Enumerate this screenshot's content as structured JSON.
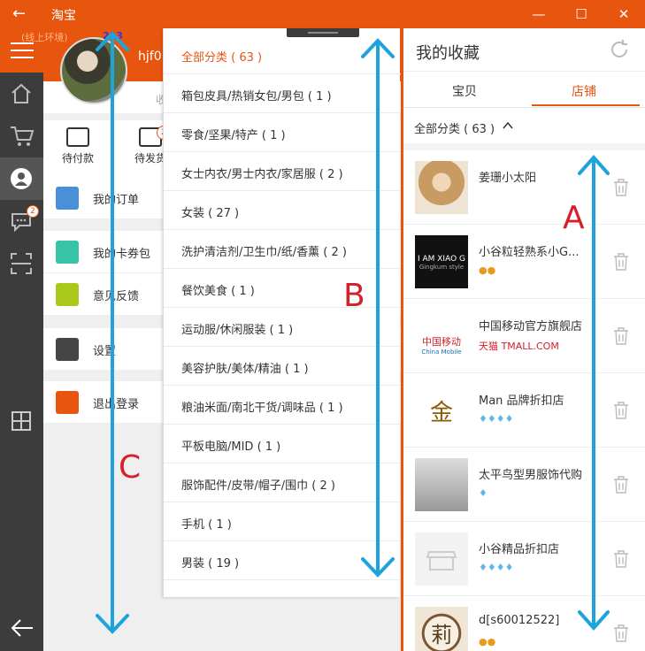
{
  "titlebar": {
    "back": "←",
    "title": "淘宝",
    "minimize": "—",
    "maximize": "☐",
    "close": "✕"
  },
  "rail": {
    "message_badge": "2"
  },
  "drawer": {
    "env_label": "(线上环境)",
    "count_label": "213",
    "username": "hjf0",
    "hint": "收",
    "orders": [
      {
        "label": "待付款"
      },
      {
        "label": "待发货",
        "badge": "2"
      }
    ],
    "menu_group1": [
      "我的订单"
    ],
    "menu_group2": [
      "我的卡券包",
      "意见反馈"
    ],
    "menu_group3": [
      "设置"
    ],
    "menu_group4": [
      "退出登录"
    ]
  },
  "categories": [
    "全部分类 ( 63 )",
    "箱包皮具/热销女包/男包 ( 1 )",
    "零食/坚果/特产 ( 1 )",
    "女士内衣/男士内衣/家居服 ( 2 )",
    "女装 ( 27 )",
    "洗护清洁剂/卫生巾/纸/香薰 ( 2 )",
    "餐饮美食 ( 1 )",
    "运动服/休闲服装 ( 1 )",
    "美容护肤/美体/精油 ( 1 )",
    "粮油米面/南北干货/调味品 ( 1 )",
    "平板电脑/MID ( 1 )",
    "服饰配件/皮带/帽子/围巾 ( 2 )",
    "手机 ( 1 )",
    "男装 ( 19 )"
  ],
  "favorites": {
    "title": "我的收藏",
    "tabs": [
      "宝贝",
      "店铺"
    ],
    "active_tab": "店铺",
    "filter": "全部分类 ( 63 )",
    "shops": [
      {
        "name": "姜珊小太阳",
        "rating": ""
      },
      {
        "name": "小谷粒轻熟系小G...",
        "rating": "●●",
        "logo_text": "I AM XIAO G",
        "logo_sub": "Gingkum style"
      },
      {
        "name": "中国移动官方旗舰店",
        "rating": "天猫 TMALL.COM",
        "logo_text": "中国移动",
        "logo_sub": "China Mobile"
      },
      {
        "name": "Man 品牌折扣店",
        "rating": "♦♦♦♦",
        "logo_text": "金"
      },
      {
        "name": "太平鸟型男服饰代购",
        "rating": "♦"
      },
      {
        "name": "小谷精品折扣店",
        "rating": "♦♦♦♦"
      },
      {
        "name": "d[s60012522]",
        "rating": "●●",
        "logo_text": "莉"
      }
    ]
  },
  "annotations": {
    "a": "A",
    "b": "B",
    "c": "C"
  },
  "colors": {
    "accent": "#e8550f",
    "arrow": "#1ea3dc",
    "annotation": "#d3202a"
  }
}
